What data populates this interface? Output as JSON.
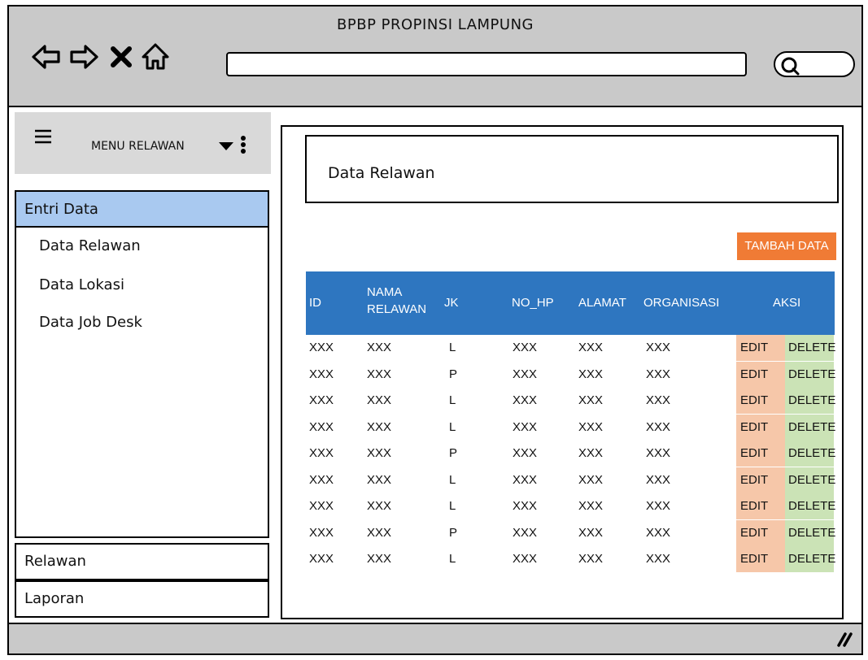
{
  "window": {
    "title": "BPBP PROPINSI LAMPUNG"
  },
  "toolbar": {
    "icons": [
      "back-arrow-icon",
      "forward-arrow-icon",
      "close-icon",
      "home-icon",
      "search-icon"
    ],
    "url": ""
  },
  "sidebar": {
    "menu_title": "MENU RELAWAN",
    "active_section": "Entri Data",
    "items": [
      "Data Relawan",
      "Data Lokasi",
      "Data Job Desk"
    ],
    "sections": [
      "Relawan",
      "Laporan"
    ]
  },
  "main": {
    "panel_title": "Data Relawan",
    "add_button": "TAMBAH DATA",
    "columns": [
      "ID",
      "NAMA RELAWAN",
      "JK",
      "NO_HP",
      "ALAMAT",
      "ORGANISASI",
      "AKSI"
    ],
    "edit_label": "EDIT",
    "delete_label": "DELETE",
    "rows": [
      [
        "XXX",
        "XXX",
        "L",
        "XXX",
        "XXX",
        "XXX"
      ],
      [
        "XXX",
        "XXX",
        "P",
        "XXX",
        "XXX",
        "XXX"
      ],
      [
        "XXX",
        "XXX",
        "L",
        "XXX",
        "XXX",
        "XXX"
      ],
      [
        "XXX",
        "XXX",
        "L",
        "XXX",
        "XXX",
        "XXX"
      ],
      [
        "XXX",
        "XXX",
        "P",
        "XXX",
        "XXX",
        "XXX"
      ],
      [
        "XXX",
        "XXX",
        "L",
        "XXX",
        "XXX",
        "XXX"
      ],
      [
        "XXX",
        "XXX",
        "L",
        "XXX",
        "XXX",
        "XXX"
      ],
      [
        "XXX",
        "XXX",
        "P",
        "XXX",
        "XXX",
        "XXX"
      ],
      [
        "XXX",
        "XXX",
        "L",
        "XXX",
        "XXX",
        "XXX"
      ]
    ]
  },
  "colors": {
    "accent_blue": "#2e76c0",
    "add_orange": "#f07b35",
    "edit_bg": "#f6c7a9",
    "delete_bg": "#cbe3b6",
    "active_nav": "#a9c9f0"
  }
}
